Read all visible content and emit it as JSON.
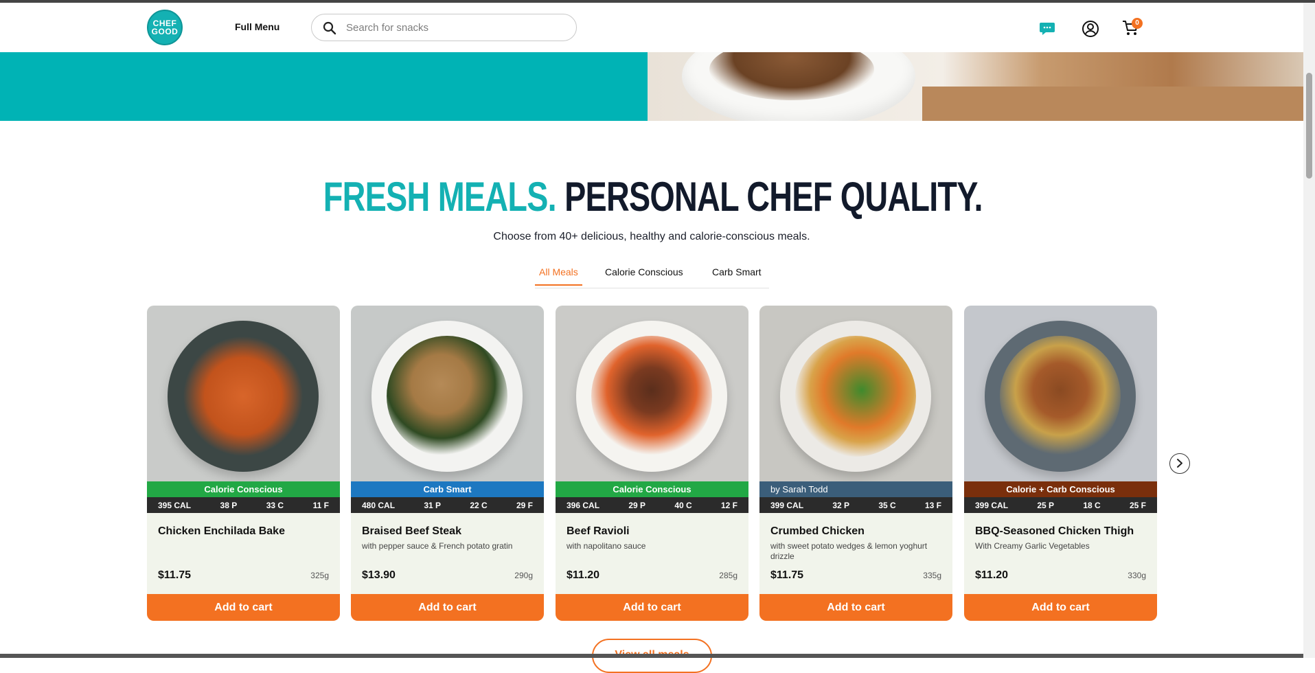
{
  "header": {
    "logo_text": "CHEF\nGOOD",
    "full_menu_label": "Full Menu",
    "search_placeholder": "Search for snacks",
    "cart_count": "0"
  },
  "intro": {
    "headline_accent": "FRESH MEALS.",
    "headline_main": "PERSONAL CHEF QUALITY.",
    "subheading": "Choose from 40+ delicious, healthy and calorie-conscious meals."
  },
  "tabs": [
    {
      "label": "All Meals",
      "active": true
    },
    {
      "label": "Calorie Conscious",
      "active": false
    },
    {
      "label": "Carb Smart",
      "active": false
    }
  ],
  "meals": [
    {
      "tag": "Calorie Conscious",
      "tag_color": "#22a845",
      "cal": "395 CAL",
      "protein": "38 P",
      "carbs": "33 C",
      "fat": "11 F",
      "name": "Chicken Enchilada Bake",
      "description": "",
      "price": "$11.75",
      "weight": "325g",
      "button": "Add to cart"
    },
    {
      "tag": "Carb Smart",
      "tag_color": "#1d78c1",
      "cal": "480 CAL",
      "protein": "31 P",
      "carbs": "22 C",
      "fat": "29 F",
      "name": "Braised Beef Steak",
      "description": "with pepper sauce & French potato gratin",
      "price": "$13.90",
      "weight": "290g",
      "button": "Add to cart"
    },
    {
      "tag": "Calorie Conscious",
      "tag_color": "#22a845",
      "cal": "396 CAL",
      "protein": "29 P",
      "carbs": "40 C",
      "fat": "12 F",
      "name": "Beef Ravioli",
      "description": "with napolitano sauce",
      "price": "$11.20",
      "weight": "285g",
      "button": "Add to cart"
    },
    {
      "tag": "by Sarah Todd",
      "tag_color": "#3b5e7a",
      "cal": "399 CAL",
      "protein": "32 P",
      "carbs": "35 C",
      "fat": "13 F",
      "name": "Crumbed Chicken",
      "description": "with sweet potato wedges & lemon yoghurt drizzle",
      "price": "$11.75",
      "weight": "335g",
      "button": "Add to cart"
    },
    {
      "tag": "Calorie + Carb Conscious",
      "tag_color": "#7a2f0c",
      "cal": "399 CAL",
      "protein": "25 P",
      "carbs": "18 C",
      "fat": "25 F",
      "name": "BBQ-Seasoned Chicken Thigh",
      "description": "With Creamy Garlic Vegetables",
      "price": "$11.20",
      "weight": "330g",
      "button": "Add to cart"
    }
  ],
  "view_all_label": "View all meals",
  "icons": {
    "search": "search-icon",
    "chat": "chat-icon",
    "account": "account-icon",
    "cart": "cart-icon",
    "next": "chevron-right-icon"
  },
  "colors": {
    "brand_teal": "#14b1b3",
    "accent_orange": "#f37121",
    "dark_text": "#121a2b"
  }
}
